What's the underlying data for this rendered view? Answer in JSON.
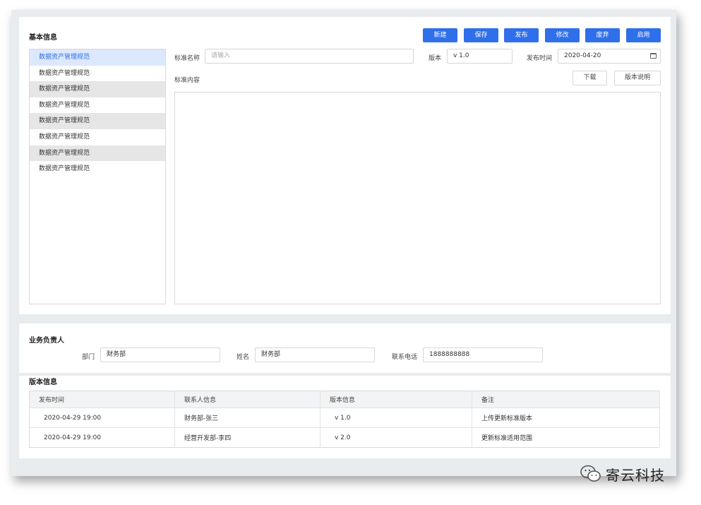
{
  "basic": {
    "title": "基本信息",
    "buttons": {
      "new": "新建",
      "save": "保存",
      "publish": "发布",
      "edit": "修改",
      "discard": "废弃",
      "enable": "启用"
    },
    "std_list": [
      "数据资产管理规范",
      "数据资产管理规范",
      "数据资产管理规范",
      "数据资产管理规范",
      "数据资产管理规范",
      "数据资产管理规范",
      "数据资产管理规范",
      "数据资产管理规范"
    ],
    "std_name_label": "标准名称",
    "std_name_placeholder": "请输入",
    "version_label": "版本",
    "version_value": "v 1.0",
    "publish_time_label": "发布时间",
    "publish_time_value": "2020-04-20",
    "content_label": "标准内容",
    "download_label": "下载",
    "version_note_label": "版本说明"
  },
  "biz": {
    "title": "业务负责人",
    "dept_label": "部门",
    "dept_value": "财务部",
    "name_label": "姓名",
    "name_value": "财务部",
    "phone_label": "联系电话",
    "phone_value": "1888888888"
  },
  "versions": {
    "title": "版本信息",
    "headers": [
      "发布时间",
      "联系人信息",
      "版本信息",
      "备注"
    ],
    "rows": [
      [
        "2020-04-29  19:00",
        "财务部-张三",
        "v 1.0",
        "上传更新标准版本"
      ],
      [
        "2020-04-29  19:00",
        "经营开发部-李四",
        "v 2.0",
        "更新标准适用范围"
      ]
    ]
  },
  "watermark": {
    "text": "寄云科技",
    "icon": "wechat-icon"
  },
  "colors": {
    "primary": "#2f6fea",
    "active_bg": "#dce8fd",
    "page_bg": "#e9ecef"
  }
}
